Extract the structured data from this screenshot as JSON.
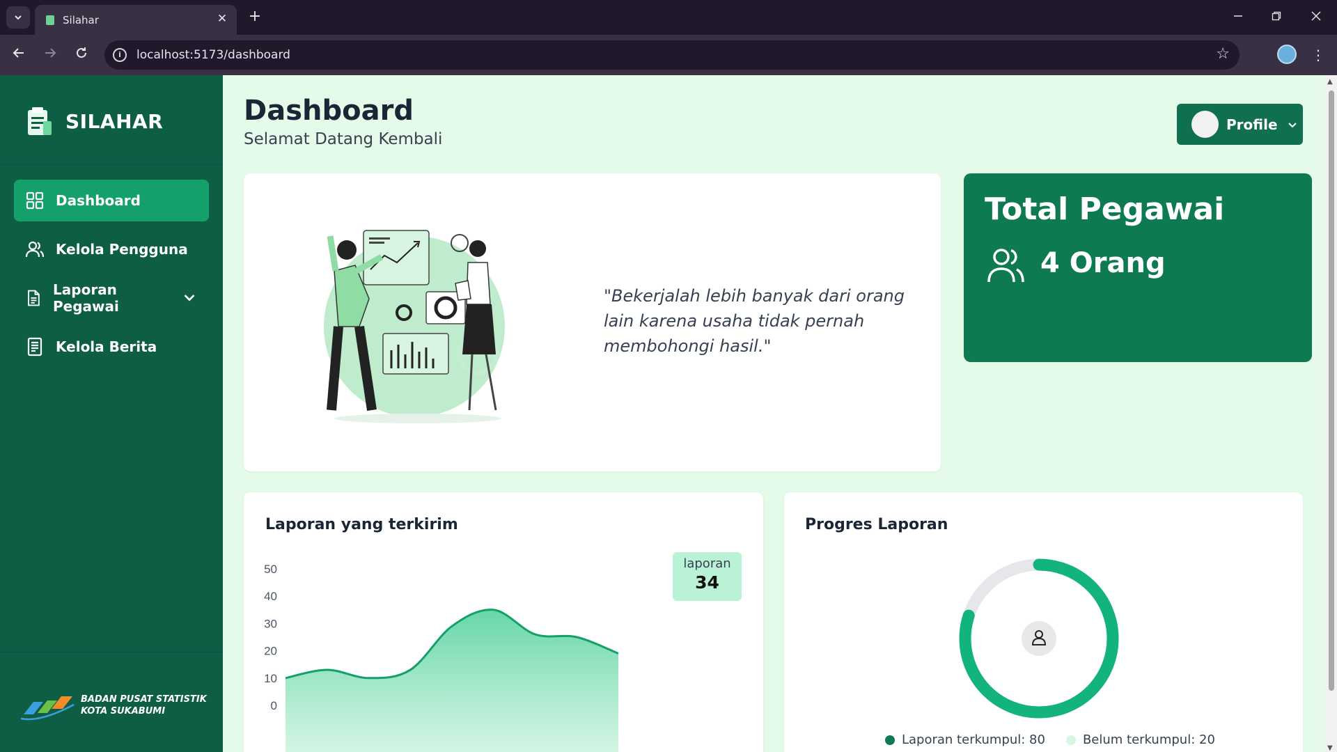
{
  "browser": {
    "tab_title": "Silahar",
    "url": "localhost:5173/dashboard",
    "new_tab": "+",
    "close": "✕"
  },
  "sidebar": {
    "brand": "SILAHAR",
    "items": [
      {
        "label": "Dashboard",
        "icon": "grid-icon",
        "active": true
      },
      {
        "label": "Kelola Pengguna",
        "icon": "users-icon",
        "active": false
      },
      {
        "label": "Laporan Pegawai",
        "icon": "document-icon",
        "active": false,
        "has_dropdown": true
      },
      {
        "label": "Kelola Berita",
        "icon": "news-icon",
        "active": false
      }
    ],
    "footer": {
      "line1": "BADAN PUSAT STATISTIK",
      "line2": "KOTA SUKABUMI"
    }
  },
  "header": {
    "title": "Dashboard",
    "subtitle": "Selamat Datang Kembali",
    "profile_label": "Profile"
  },
  "hero": {
    "quote": "\"Bekerjalah lebih banyak dari orang lain karena usaha tidak pernah membohongi hasil.\""
  },
  "total": {
    "title": "Total Pegawai",
    "value": "4 Orang"
  },
  "chart_card": {
    "title": "Laporan yang terkirim",
    "badge_label": "laporan",
    "badge_value": "34"
  },
  "chart_data": {
    "type": "area",
    "title": "Laporan yang terkirim",
    "xlabel": "",
    "ylabel": "",
    "ylim": [
      0,
      50
    ],
    "yticks": [
      0,
      10,
      20,
      30,
      40,
      50
    ],
    "x": [
      0,
      1,
      2,
      3,
      4,
      5,
      6,
      7,
      8
    ],
    "values": [
      10,
      13,
      10,
      13,
      29,
      35,
      26,
      25,
      19
    ],
    "grid": false,
    "legend": "none"
  },
  "progress": {
    "title": "Progres Laporan",
    "collected_label": "Laporan terkumpul: 80",
    "pending_label": "Belum terkumpul: 20",
    "collected": 80,
    "pending": 20,
    "colors": {
      "collected": "#13b47c",
      "pending": "#e5e7eb"
    }
  },
  "colors": {
    "sidebar": "#0e5e46",
    "accent": "#13a06a",
    "background": "#e3fbe8",
    "card_green": "#0e7a52"
  }
}
